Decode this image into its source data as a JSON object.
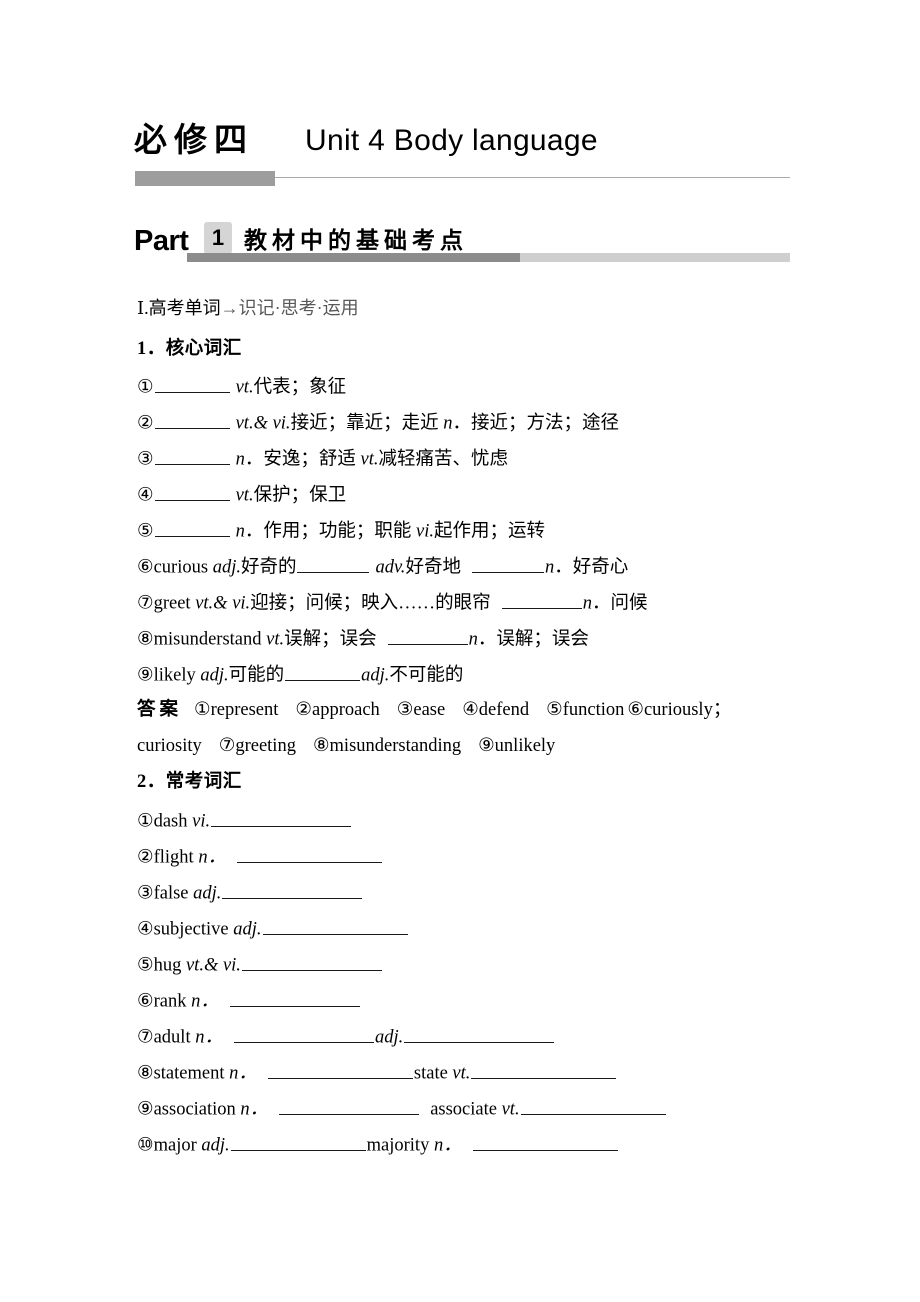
{
  "header": {
    "book_label": "必修四",
    "unit_title": "Unit 4  Body language"
  },
  "part": {
    "part_word": "Part",
    "badge_number": "1",
    "part_title_cn": "教材中的基础考点"
  },
  "section": {
    "roman_label": "Ⅰ",
    "roman_title_black": ".高考单词",
    "roman_title_gray": "→识记·思考·运用"
  },
  "core_vocab": {
    "heading": "1．核心词汇",
    "items": [
      {
        "num": "①",
        "pre": "",
        "body": "vt.代表；象征"
      },
      {
        "num": "②",
        "pre": "",
        "body": "vt.& vi.接近；靠近；走近  n．接近；方法；途径"
      },
      {
        "num": "③",
        "pre": "",
        "body": "n．安逸；舒适  vt.减轻痛苦、忧虑"
      },
      {
        "num": "④",
        "pre": "",
        "body": "vt.保护；保卫"
      },
      {
        "num": "⑤",
        "pre": "",
        "body": "n．作用；功能；职能  vi.起作用；运转"
      },
      {
        "num": "⑥",
        "pre": "curious adj.好奇的",
        "mid": "adv.好奇地",
        "post": "n．好奇心"
      },
      {
        "num": "⑦",
        "pre": "greet vt.& vi.迎接；问候；映入……的眼帘",
        "post": "n．问候"
      },
      {
        "num": "⑧",
        "pre": "misunderstand vt.误解；误会",
        "post": "n．误解；误会"
      },
      {
        "num": "⑨",
        "pre": "likely adj.可能的",
        "post": "adj.不可能的"
      }
    ],
    "answer_label": "答案",
    "answers_line1": [
      "①represent",
      "②approach",
      "③ease",
      "④defend",
      "⑤function",
      "⑥curiously；"
    ],
    "answers_line2": [
      "curiosity",
      "⑦greeting",
      "⑧misunderstanding",
      "⑨unlikely"
    ]
  },
  "common_vocab": {
    "heading": "2．常考词汇",
    "items": [
      {
        "num": "①",
        "word": "dash",
        "pos": "vi."
      },
      {
        "num": "②",
        "word": "flight",
        "pos": "n．"
      },
      {
        "num": "③",
        "word": "false",
        "pos": "adj."
      },
      {
        "num": "④",
        "word": "subjective",
        "pos": "adj."
      },
      {
        "num": "⑤",
        "word": "hug",
        "pos": "vt.& vi."
      },
      {
        "num": "⑥",
        "word": "rank",
        "pos": "n．"
      },
      {
        "num": "⑦",
        "word": "adult",
        "pos": "n．",
        "word2": "",
        "pos2": "adj."
      },
      {
        "num": "⑧",
        "word": "statement",
        "pos": "n．",
        "word2": "state",
        "pos2": "vt."
      },
      {
        "num": "⑨",
        "word": "association",
        "pos": "n．",
        "word2": "associate",
        "pos2": "vt."
      },
      {
        "num": "⑩",
        "word": "major",
        "pos": "adj.",
        "word2": "majority",
        "pos2": "n．"
      }
    ]
  },
  "colors": {
    "rule_dark": "#9d9d9d",
    "rule_part_dark": "#8c8c8c",
    "rule_part_light": "#cfcfcf",
    "badge_bg": "#d5d5d5",
    "gray_text": "#585858"
  }
}
